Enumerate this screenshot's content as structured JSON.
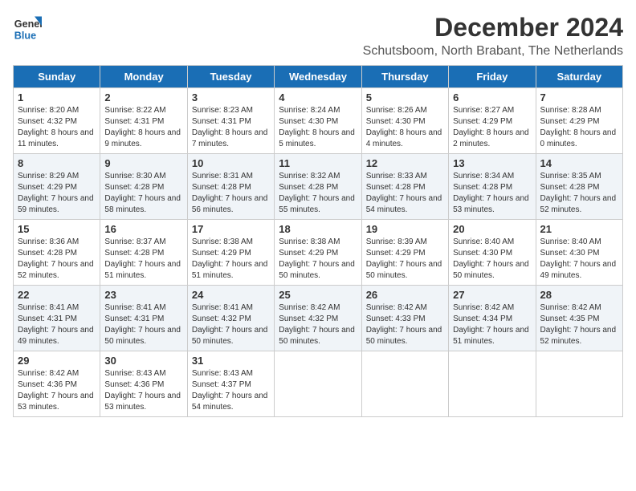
{
  "logo": {
    "line1": "General",
    "line2": "Blue"
  },
  "title": "December 2024",
  "subtitle": "Schutsboom, North Brabant, The Netherlands",
  "weekdays": [
    "Sunday",
    "Monday",
    "Tuesday",
    "Wednesday",
    "Thursday",
    "Friday",
    "Saturday"
  ],
  "weeks": [
    [
      {
        "day": "1",
        "sunrise": "8:20 AM",
        "sunset": "4:32 PM",
        "daylight": "8 hours and 11 minutes."
      },
      {
        "day": "2",
        "sunrise": "8:22 AM",
        "sunset": "4:31 PM",
        "daylight": "8 hours and 9 minutes."
      },
      {
        "day": "3",
        "sunrise": "8:23 AM",
        "sunset": "4:31 PM",
        "daylight": "8 hours and 7 minutes."
      },
      {
        "day": "4",
        "sunrise": "8:24 AM",
        "sunset": "4:30 PM",
        "daylight": "8 hours and 5 minutes."
      },
      {
        "day": "5",
        "sunrise": "8:26 AM",
        "sunset": "4:30 PM",
        "daylight": "8 hours and 4 minutes."
      },
      {
        "day": "6",
        "sunrise": "8:27 AM",
        "sunset": "4:29 PM",
        "daylight": "8 hours and 2 minutes."
      },
      {
        "day": "7",
        "sunrise": "8:28 AM",
        "sunset": "4:29 PM",
        "daylight": "8 hours and 0 minutes."
      }
    ],
    [
      {
        "day": "8",
        "sunrise": "8:29 AM",
        "sunset": "4:29 PM",
        "daylight": "7 hours and 59 minutes."
      },
      {
        "day": "9",
        "sunrise": "8:30 AM",
        "sunset": "4:28 PM",
        "daylight": "7 hours and 58 minutes."
      },
      {
        "day": "10",
        "sunrise": "8:31 AM",
        "sunset": "4:28 PM",
        "daylight": "7 hours and 56 minutes."
      },
      {
        "day": "11",
        "sunrise": "8:32 AM",
        "sunset": "4:28 PM",
        "daylight": "7 hours and 55 minutes."
      },
      {
        "day": "12",
        "sunrise": "8:33 AM",
        "sunset": "4:28 PM",
        "daylight": "7 hours and 54 minutes."
      },
      {
        "day": "13",
        "sunrise": "8:34 AM",
        "sunset": "4:28 PM",
        "daylight": "7 hours and 53 minutes."
      },
      {
        "day": "14",
        "sunrise": "8:35 AM",
        "sunset": "4:28 PM",
        "daylight": "7 hours and 52 minutes."
      }
    ],
    [
      {
        "day": "15",
        "sunrise": "8:36 AM",
        "sunset": "4:28 PM",
        "daylight": "7 hours and 52 minutes."
      },
      {
        "day": "16",
        "sunrise": "8:37 AM",
        "sunset": "4:28 PM",
        "daylight": "7 hours and 51 minutes."
      },
      {
        "day": "17",
        "sunrise": "8:38 AM",
        "sunset": "4:29 PM",
        "daylight": "7 hours and 51 minutes."
      },
      {
        "day": "18",
        "sunrise": "8:38 AM",
        "sunset": "4:29 PM",
        "daylight": "7 hours and 50 minutes."
      },
      {
        "day": "19",
        "sunrise": "8:39 AM",
        "sunset": "4:29 PM",
        "daylight": "7 hours and 50 minutes."
      },
      {
        "day": "20",
        "sunrise": "8:40 AM",
        "sunset": "4:30 PM",
        "daylight": "7 hours and 50 minutes."
      },
      {
        "day": "21",
        "sunrise": "8:40 AM",
        "sunset": "4:30 PM",
        "daylight": "7 hours and 49 minutes."
      }
    ],
    [
      {
        "day": "22",
        "sunrise": "8:41 AM",
        "sunset": "4:31 PM",
        "daylight": "7 hours and 49 minutes."
      },
      {
        "day": "23",
        "sunrise": "8:41 AM",
        "sunset": "4:31 PM",
        "daylight": "7 hours and 50 minutes."
      },
      {
        "day": "24",
        "sunrise": "8:41 AM",
        "sunset": "4:32 PM",
        "daylight": "7 hours and 50 minutes."
      },
      {
        "day": "25",
        "sunrise": "8:42 AM",
        "sunset": "4:32 PM",
        "daylight": "7 hours and 50 minutes."
      },
      {
        "day": "26",
        "sunrise": "8:42 AM",
        "sunset": "4:33 PM",
        "daylight": "7 hours and 50 minutes."
      },
      {
        "day": "27",
        "sunrise": "8:42 AM",
        "sunset": "4:34 PM",
        "daylight": "7 hours and 51 minutes."
      },
      {
        "day": "28",
        "sunrise": "8:42 AM",
        "sunset": "4:35 PM",
        "daylight": "7 hours and 52 minutes."
      }
    ],
    [
      {
        "day": "29",
        "sunrise": "8:42 AM",
        "sunset": "4:36 PM",
        "daylight": "7 hours and 53 minutes."
      },
      {
        "day": "30",
        "sunrise": "8:43 AM",
        "sunset": "4:36 PM",
        "daylight": "7 hours and 53 minutes."
      },
      {
        "day": "31",
        "sunrise": "8:43 AM",
        "sunset": "4:37 PM",
        "daylight": "7 hours and 54 minutes."
      },
      null,
      null,
      null,
      null
    ]
  ]
}
